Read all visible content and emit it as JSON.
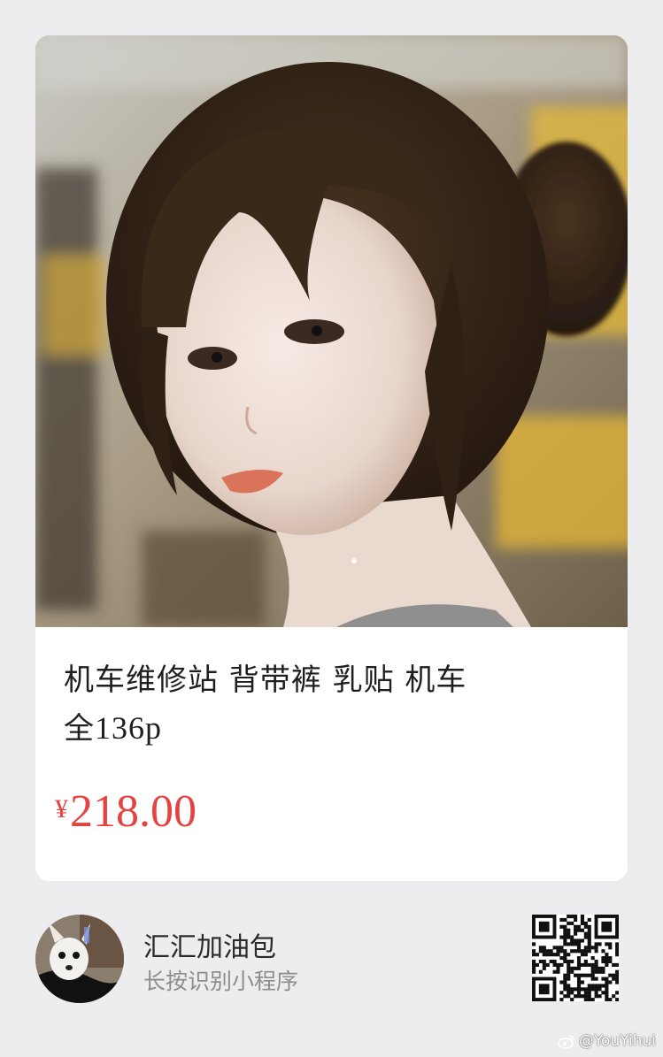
{
  "product": {
    "image_alt": "product photo",
    "title_line1": "机车维修站  背带裤  乳贴 机车",
    "title_line2_prefix": "全",
    "title_line2_count": "136p",
    "price_currency": "¥",
    "price_value": "218.00"
  },
  "shop": {
    "name": "汇汇加油包",
    "hint": "长按识别小程序"
  },
  "watermark": {
    "text": "@YouYihui",
    "icon": "weibo-icon"
  },
  "colors": {
    "price": "#e64340",
    "background": "#ededf0",
    "card": "#ffffff"
  }
}
